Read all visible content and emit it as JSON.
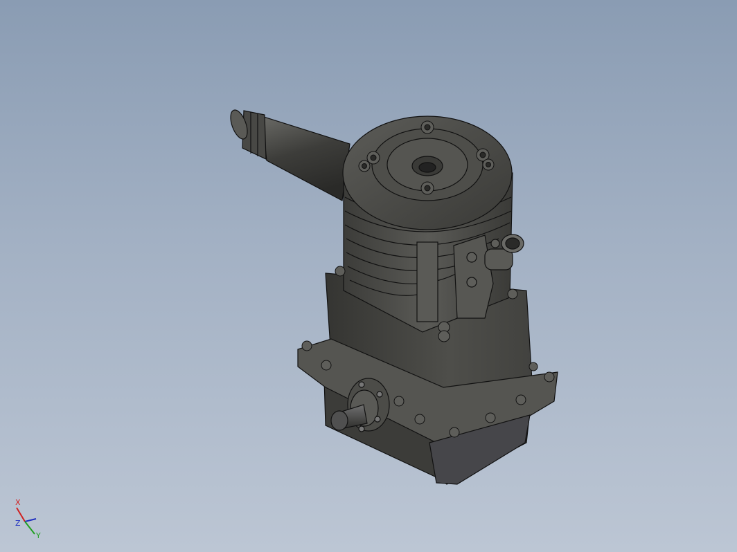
{
  "viewport": {
    "background_top": "#8a9cb3",
    "background_bottom": "#bcc6d4",
    "model_name": "",
    "model_color": "#4a4a48",
    "edge_color": "#111111"
  },
  "triad": {
    "x_label": "X",
    "y_label": "Y",
    "z_label": "Z",
    "x_color": "#d02020",
    "y_color": "#20a020",
    "z_color": "#2030c0"
  }
}
